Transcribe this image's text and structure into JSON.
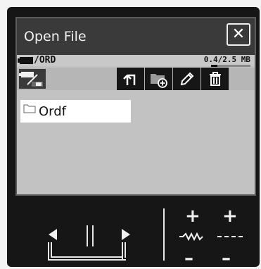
{
  "dialog": {
    "title": "Open File",
    "close_label": "✕"
  },
  "path_bar": {
    "path": "/ORD",
    "storage_text": "0.4/2.5 MB",
    "storage_fraction": 0.16
  },
  "toolbar": {
    "device_icon": "usb-device-icon",
    "buttons": [
      {
        "name": "back-button",
        "icon": "return-arrow-icon"
      },
      {
        "name": "new-folder-button",
        "icon": "folder-add-icon"
      },
      {
        "name": "rename-button",
        "icon": "pencil-icon"
      },
      {
        "name": "delete-button",
        "icon": "trash-icon"
      }
    ]
  },
  "files": [
    {
      "name": "Ordf",
      "type": "folder"
    }
  ],
  "controls": {
    "plus_labels": [
      "+",
      "+"
    ],
    "minus_labels": [
      "–",
      "–"
    ],
    "left_icon": "arrow-left-icon",
    "right_icon": "arrow-right-icon"
  }
}
